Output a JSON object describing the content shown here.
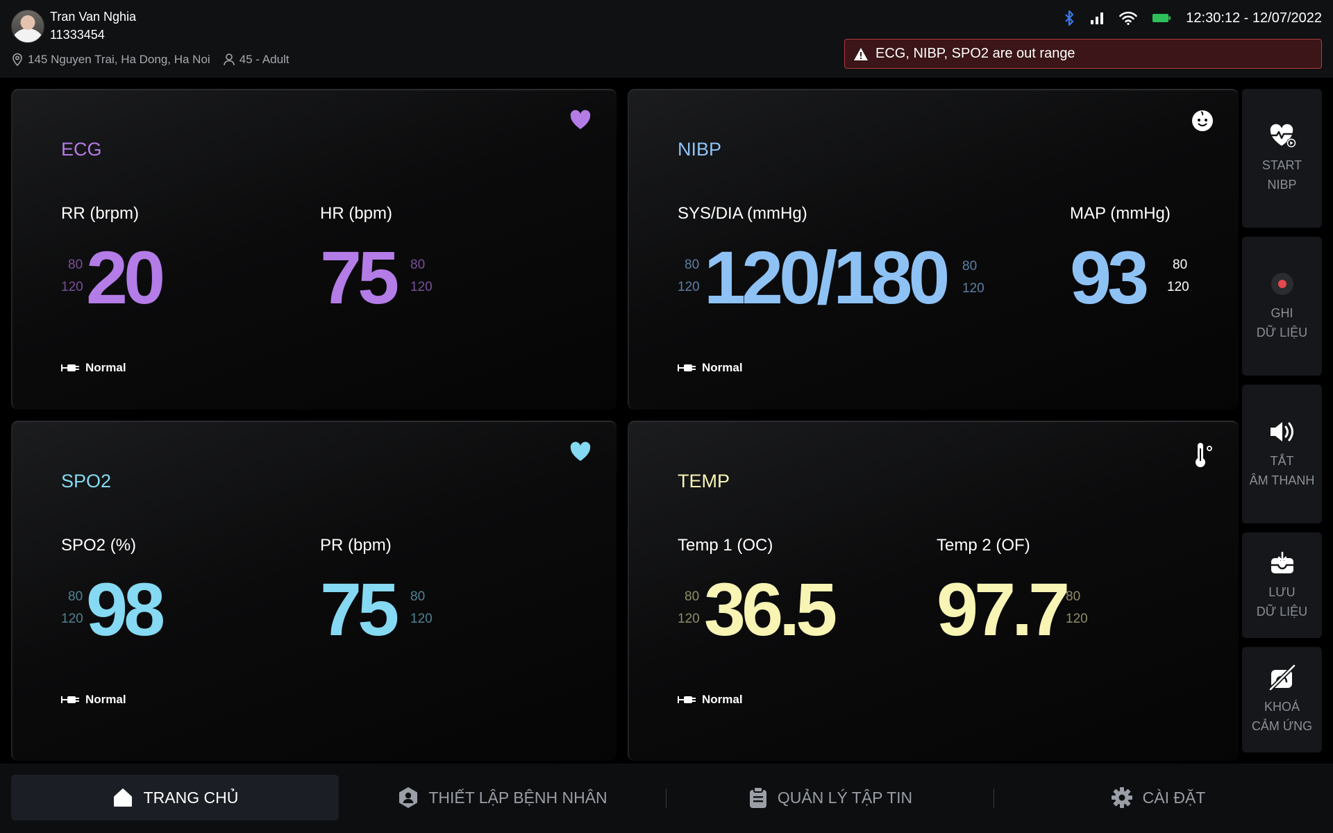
{
  "patient": {
    "name": "Tran Van Nghia",
    "id": "11333454",
    "address": "145 Nguyen Trai, Ha Dong, Ha Noi",
    "age_group": "45 - Adult"
  },
  "status": {
    "datetime": "12:30:12 - 12/07/2022"
  },
  "alert": {
    "text": "ECG, NIBP, SPO2 are out range"
  },
  "colors": {
    "ecg": "#b37ce6",
    "nibp": "#8ec2f5",
    "spo2": "#85d9f2",
    "temp": "#f7f4b4",
    "bluetooth": "#3a7bf0",
    "battery": "#2fbf5a",
    "alert_border": "#b23a3f"
  },
  "panels": {
    "ecg": {
      "title": "ECG",
      "metrics": [
        {
          "label": "RR (brpm)",
          "value": "20",
          "low": "80",
          "high": "120"
        },
        {
          "label": "HR (bpm)",
          "value": "75",
          "low": "80",
          "high": "120"
        }
      ],
      "status": "Normal",
      "icon": "heart-icon"
    },
    "nibp": {
      "title": "NIBP",
      "metrics": [
        {
          "label": "SYS/DIA (mmHg)",
          "value": "120/180",
          "low": "80",
          "high": "120",
          "low2": "80",
          "high2": "120"
        },
        {
          "label": "MAP (mmHg)",
          "value": "93",
          "low": "80",
          "high": "120"
        }
      ],
      "status": "Normal",
      "icon": "baby-face-icon"
    },
    "spo2": {
      "title": "SPO2",
      "metrics": [
        {
          "label": "SPO2 (%)",
          "value": "98",
          "low": "80",
          "high": "120"
        },
        {
          "label": "PR (bpm)",
          "value": "75",
          "low": "80",
          "high": "120"
        }
      ],
      "status": "Normal",
      "icon": "heart-icon"
    },
    "temp": {
      "title": "TEMP",
      "metrics": [
        {
          "label": "Temp 1 (OC)",
          "value": "36.5",
          "low": "80",
          "high": "120"
        },
        {
          "label": "Temp 2 (OF)",
          "value": "97.7",
          "low": "80",
          "high": "120"
        }
      ],
      "status": "Normal",
      "icon": "thermometer-icon"
    }
  },
  "side_actions": [
    {
      "line1": "START",
      "line2": "NIBP",
      "icon": "heart-monitor-play-icon"
    },
    {
      "line1": "GHI",
      "line2": "DỮ LIỆU",
      "icon": "record-icon"
    },
    {
      "line1": "TẮT",
      "line2": "ÂM THANH",
      "icon": "speaker-icon"
    },
    {
      "line1": "LƯU",
      "line2": "DỮ LIỆU",
      "icon": "save-tray-icon"
    },
    {
      "line1": "KHOÁ",
      "line2": "CẢM ỨNG",
      "icon": "touch-lock-icon"
    }
  ],
  "nav": [
    {
      "label": "TRANG CHỦ",
      "icon": "home-icon",
      "active": true
    },
    {
      "label": "THIẾT LẬP BỆNH NHÂN",
      "icon": "patient-icon",
      "active": false
    },
    {
      "label": "QUẢN LÝ TẬP TIN",
      "icon": "clipboard-icon",
      "active": false
    },
    {
      "label": "CÀI ĐẶT",
      "icon": "gear-icon",
      "active": false
    }
  ]
}
